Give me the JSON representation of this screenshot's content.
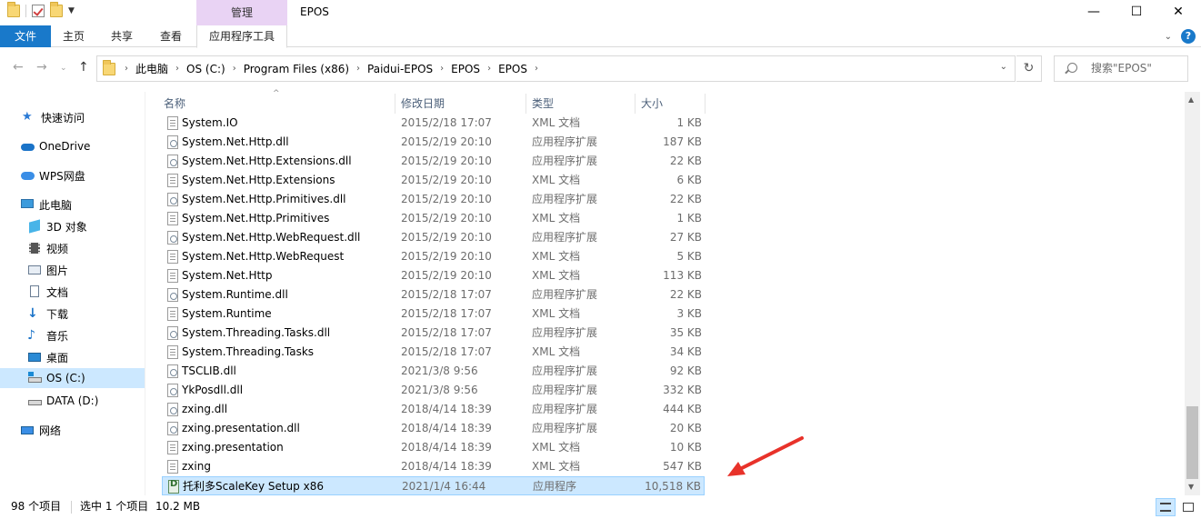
{
  "window": {
    "title": "EPOS",
    "manage_label": "管理",
    "minimize": "—",
    "maximize": "☐",
    "close": "✕"
  },
  "ribbon": {
    "tabs": [
      "文件",
      "主页",
      "共享",
      "查看",
      "应用程序工具"
    ],
    "help": "?"
  },
  "address": {
    "crumbs": [
      "此电脑",
      "OS (C:)",
      "Program Files (x86)",
      "Paidui-EPOS",
      "EPOS",
      "EPOS"
    ],
    "search_placeholder": "搜索\"EPOS\""
  },
  "nav": {
    "items": [
      {
        "label": "快速访问",
        "icon": "star-icon"
      },
      {
        "label": "OneDrive",
        "icon": "cloud-icon"
      },
      {
        "label": "WPS网盘",
        "icon": "wps-cloud-icon"
      },
      {
        "label": "此电脑",
        "icon": "computer-icon"
      },
      {
        "label": "3D 对象",
        "icon": "3d-objects-icon"
      },
      {
        "label": "视频",
        "icon": "video-icon"
      },
      {
        "label": "图片",
        "icon": "pictures-icon"
      },
      {
        "label": "文档",
        "icon": "documents-icon"
      },
      {
        "label": "下载",
        "icon": "download-icon"
      },
      {
        "label": "音乐",
        "icon": "music-icon"
      },
      {
        "label": "桌面",
        "icon": "desktop-icon"
      },
      {
        "label": "OS (C:)",
        "icon": "drive-c-icon"
      },
      {
        "label": "DATA (D:)",
        "icon": "drive-d-icon"
      },
      {
        "label": "网络",
        "icon": "network-icon"
      }
    ]
  },
  "columns": [
    "名称",
    "修改日期",
    "类型",
    "大小"
  ],
  "files": [
    {
      "name": "System.IO",
      "date": "2015/2/18 17:07",
      "type": "XML 文档",
      "size": "1 KB",
      "kind": "xml"
    },
    {
      "name": "System.Net.Http.dll",
      "date": "2015/2/19 20:10",
      "type": "应用程序扩展",
      "size": "187 KB",
      "kind": "dll"
    },
    {
      "name": "System.Net.Http.Extensions.dll",
      "date": "2015/2/19 20:10",
      "type": "应用程序扩展",
      "size": "22 KB",
      "kind": "dll"
    },
    {
      "name": "System.Net.Http.Extensions",
      "date": "2015/2/19 20:10",
      "type": "XML 文档",
      "size": "6 KB",
      "kind": "xml"
    },
    {
      "name": "System.Net.Http.Primitives.dll",
      "date": "2015/2/19 20:10",
      "type": "应用程序扩展",
      "size": "22 KB",
      "kind": "dll"
    },
    {
      "name": "System.Net.Http.Primitives",
      "date": "2015/2/19 20:10",
      "type": "XML 文档",
      "size": "1 KB",
      "kind": "xml"
    },
    {
      "name": "System.Net.Http.WebRequest.dll",
      "date": "2015/2/19 20:10",
      "type": "应用程序扩展",
      "size": "27 KB",
      "kind": "dll"
    },
    {
      "name": "System.Net.Http.WebRequest",
      "date": "2015/2/19 20:10",
      "type": "XML 文档",
      "size": "5 KB",
      "kind": "xml"
    },
    {
      "name": "System.Net.Http",
      "date": "2015/2/19 20:10",
      "type": "XML 文档",
      "size": "113 KB",
      "kind": "xml"
    },
    {
      "name": "System.Runtime.dll",
      "date": "2015/2/18 17:07",
      "type": "应用程序扩展",
      "size": "22 KB",
      "kind": "dll"
    },
    {
      "name": "System.Runtime",
      "date": "2015/2/18 17:07",
      "type": "XML 文档",
      "size": "3 KB",
      "kind": "xml"
    },
    {
      "name": "System.Threading.Tasks.dll",
      "date": "2015/2/18 17:07",
      "type": "应用程序扩展",
      "size": "35 KB",
      "kind": "dll"
    },
    {
      "name": "System.Threading.Tasks",
      "date": "2015/2/18 17:07",
      "type": "XML 文档",
      "size": "34 KB",
      "kind": "xml"
    },
    {
      "name": "TSCLIB.dll",
      "date": "2021/3/8 9:56",
      "type": "应用程序扩展",
      "size": "92 KB",
      "kind": "dll"
    },
    {
      "name": "YkPosdll.dll",
      "date": "2021/3/8 9:56",
      "type": "应用程序扩展",
      "size": "332 KB",
      "kind": "dll"
    },
    {
      "name": "zxing.dll",
      "date": "2018/4/14 18:39",
      "type": "应用程序扩展",
      "size": "444 KB",
      "kind": "dll"
    },
    {
      "name": "zxing.presentation.dll",
      "date": "2018/4/14 18:39",
      "type": "应用程序扩展",
      "size": "20 KB",
      "kind": "dll"
    },
    {
      "name": "zxing.presentation",
      "date": "2018/4/14 18:39",
      "type": "XML 文档",
      "size": "10 KB",
      "kind": "xml"
    },
    {
      "name": "zxing",
      "date": "2018/4/14 18:39",
      "type": "XML 文档",
      "size": "547 KB",
      "kind": "xml"
    },
    {
      "name": "托利多ScaleKey Setup x86",
      "date": "2021/1/4 16:44",
      "type": "应用程序",
      "size": "10,518 KB",
      "kind": "exe",
      "selected": true
    }
  ],
  "status": {
    "count": "98 个项目",
    "selection": "选中 1 个项目",
    "size": "10.2 MB"
  },
  "colors": {
    "accent": "#1979ca",
    "selection": "#cce8ff",
    "manage_tab": "#e9d3f4",
    "annotation_arrow": "#e8322a"
  }
}
